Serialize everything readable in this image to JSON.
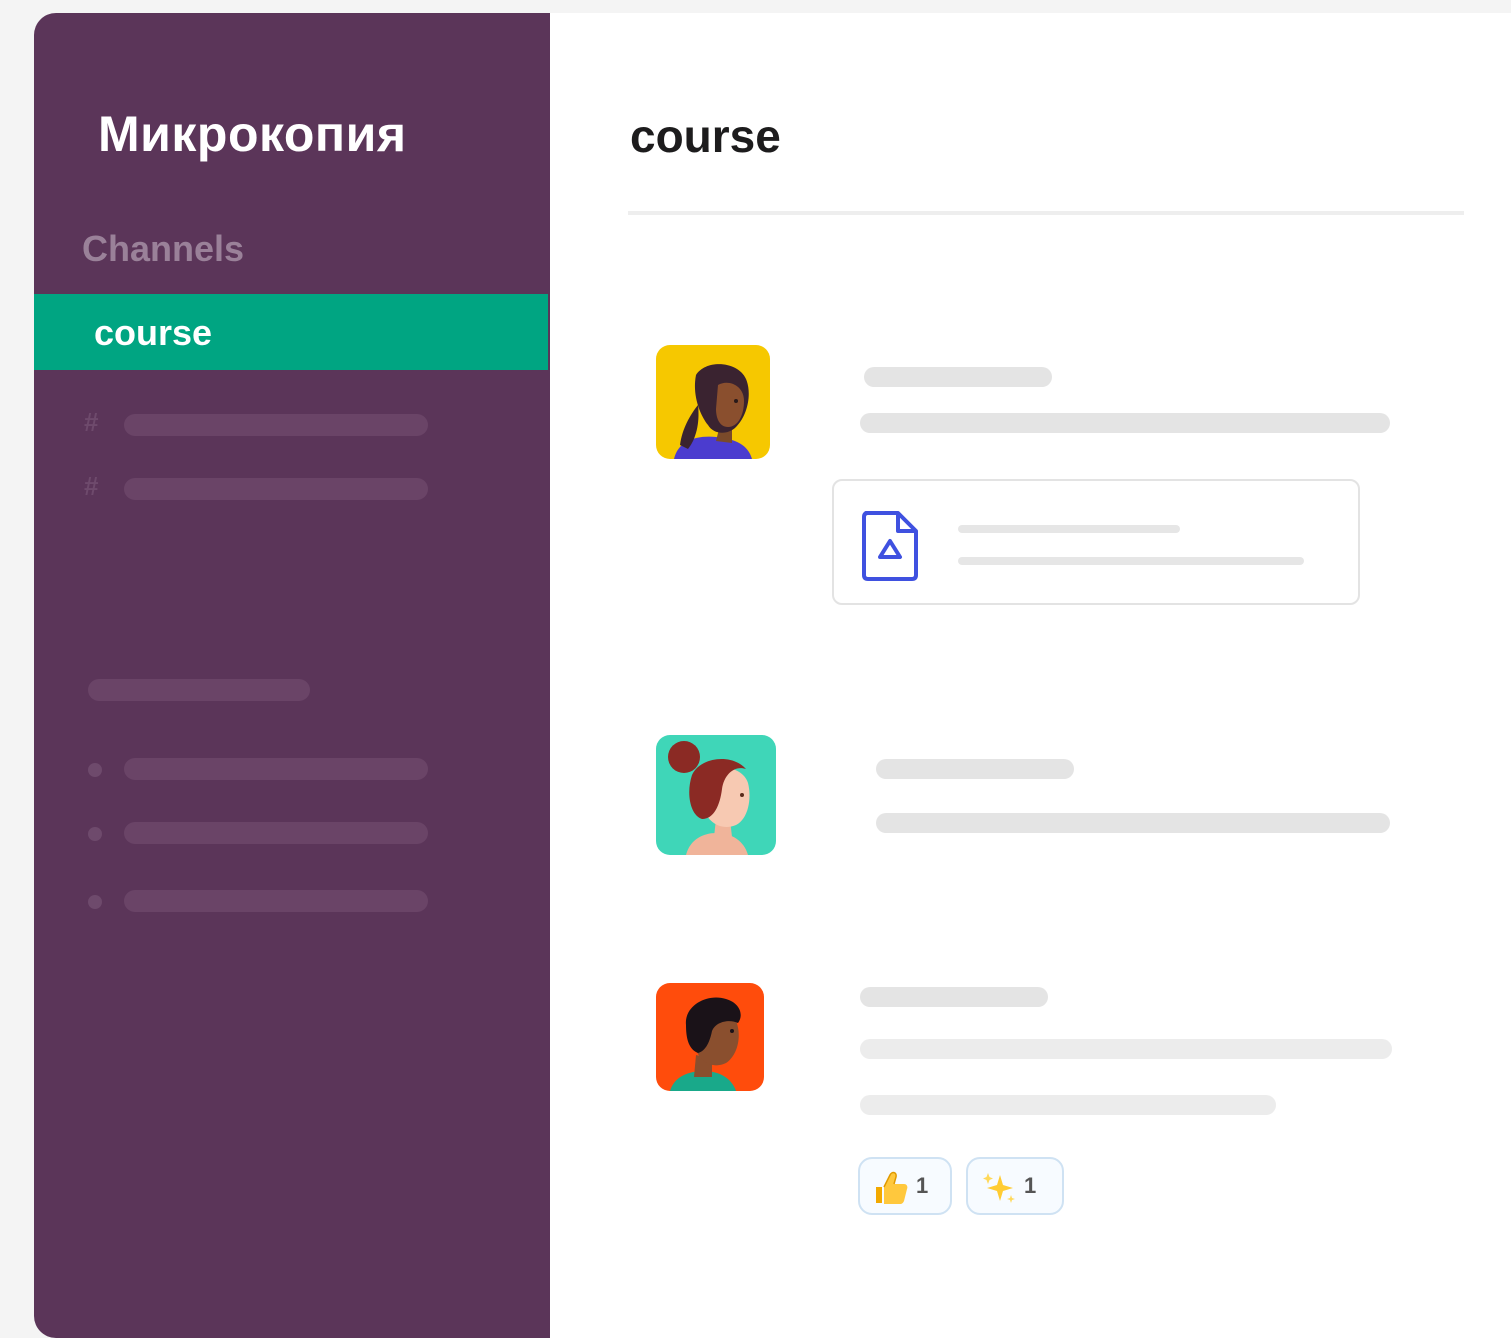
{
  "sidebar": {
    "workspace_title": "Микрокопия",
    "section_label": "Channels",
    "active_channel": "course",
    "channel_placeholder_icon": "hash-icon",
    "dm_placeholder_icon": "presence-dot-icon"
  },
  "main": {
    "channel_title": "course",
    "messages": [
      {
        "avatar_icon": "avatar-woman-yellow-icon",
        "attachment_icon": "google-drive-file-icon"
      },
      {
        "avatar_icon": "avatar-woman-teal-icon"
      },
      {
        "avatar_icon": "avatar-man-orange-icon",
        "reactions": [
          {
            "emoji_icon": "thumbs-up-icon",
            "count": "1"
          },
          {
            "emoji_icon": "sparkles-icon",
            "count": "1"
          }
        ]
      }
    ]
  },
  "colors": {
    "sidebar_bg": "#5b3559",
    "active_channel_bg": "#00a582",
    "file_icon": "#3f51e0"
  }
}
